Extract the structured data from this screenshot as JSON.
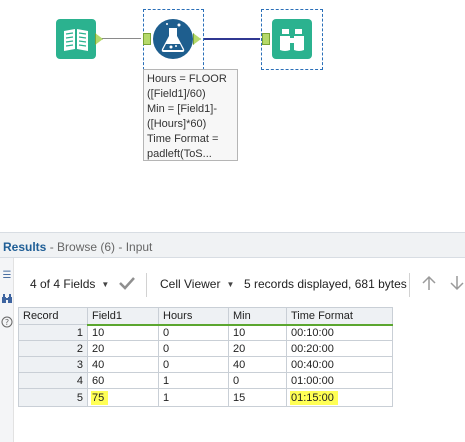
{
  "workflow": {
    "tools": [
      {
        "name": "Input Data",
        "icon": "book-icon"
      },
      {
        "name": "Formula",
        "icon": "flask-icon"
      },
      {
        "name": "Browse",
        "icon": "binoculars-icon"
      }
    ],
    "annotation_lines": [
      "Hours = FLOOR",
      "([Field1]/60)",
      "Min = [Field1]-",
      "([Hours]*60)",
      "Time Format =",
      "padleft(ToS..."
    ]
  },
  "results": {
    "title": "Results",
    "subtitle": " - Browse (6) - Input",
    "toolbar": {
      "fields_label": "4 of 4 Fields",
      "viewer_label": "Cell Viewer",
      "info": "5 records displayed, 681 bytes"
    },
    "columns": [
      "Record",
      "Field1",
      "Hours",
      "Min",
      "Time Format"
    ],
    "rows": [
      [
        "1",
        "10",
        "0",
        "10",
        "00:10:00"
      ],
      [
        "2",
        "20",
        "0",
        "20",
        "00:20:00"
      ],
      [
        "3",
        "40",
        "0",
        "40",
        "00:40:00"
      ],
      [
        "4",
        "60",
        "1",
        "0",
        "01:00:00"
      ],
      [
        "5",
        "75",
        "1",
        "15",
        "01:15:00"
      ]
    ]
  },
  "colors": {
    "tool_green": "#2bb28f",
    "tool_blue": "#1e5e8e",
    "highlight": "#ffff55",
    "header_accent": "#5ba62f"
  }
}
